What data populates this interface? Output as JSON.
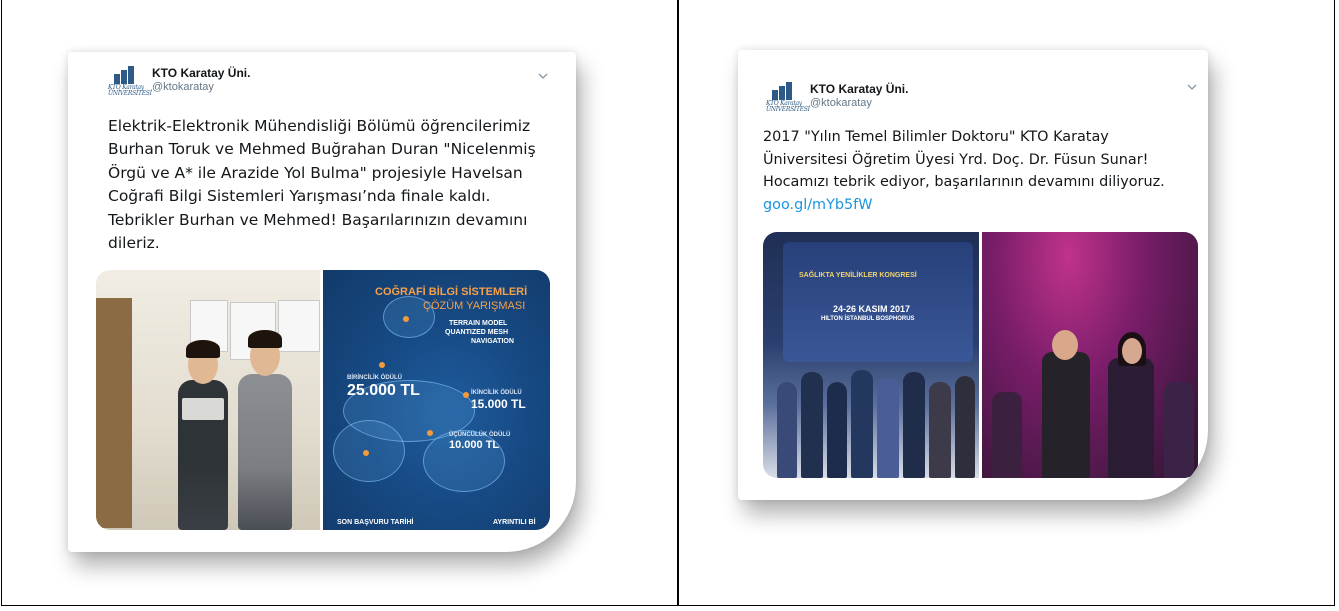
{
  "left_tweet": {
    "author_name": "KTO Karatay Üni.",
    "author_handle": "@ktokaratay",
    "logo_caption": "KTO Karatay ÜNİVERSİTESİ",
    "text_lines": [
      "Elektrik-Elektronik Mühendisliği Bölümü öğrencilerimiz",
      "Burhan Toruk ve Mehmed Buğrahan Duran \"Nicelenmiş",
      "Örgü ve A* ile Arazide Yol Bulma\" projesiyle Havelsan",
      "Coğrafi Bilgi Sistemleri Yarışması’nda finale kaldı.",
      "Tebrikler Burhan ve Mehmed! Başarılarınızın devamını",
      "dileriz."
    ],
    "poster": {
      "title_line1": "COĞRAFİ BİLGİ SİSTEMLERİ",
      "title_line2": "ÇÖZÜM YARIŞMASI",
      "tags": [
        "TERRAIN MODEL",
        "QUANTIZED MESH",
        "NAVIGATION"
      ],
      "first_label": "BİRİNCİLİK ÖDÜLÜ",
      "first_value": "25.000 TL",
      "second_label": "İKİNCİLİK ÖDÜLÜ",
      "second_value": "15.000 TL",
      "third_label": "ÜÇÜNCÜLÜK ÖDÜLÜ",
      "third_value": "10.000 TL",
      "footer_left": "SON BAŞVURU TARİHİ",
      "footer_right": "AYRINTILI Bİ"
    }
  },
  "right_tweet": {
    "author_name": "KTO Karatay Üni.",
    "author_handle": "@ktokaratay",
    "logo_caption": "KTO Karatay ÜNİVERSİTESİ",
    "text_lines": [
      "2017 \"Yılın Temel Bilimler Doktoru\" KTO Karatay",
      "Üniversitesi Öğretim Üyesi Yrd. Doç. Dr. Füsun Sunar!",
      "Hocamızı tebrik ediyor, başarılarının devamını diliyoruz."
    ],
    "link": "goo.gl/mYb5fW",
    "banner": {
      "title": "SAĞLIKTA YENİLİKLER KONGRESİ",
      "dates": "24-26 KASIM 2017",
      "venue": "HILTON İSTANBUL BOSPHORUS"
    }
  },
  "colors": {
    "link": "#1b95e0",
    "handle": "#657786",
    "text": "#14171a",
    "poster_orange": "#f5a04a",
    "poster_blue": "#174a84"
  },
  "icons": [
    "chevron-down-icon",
    "university-logo-icon"
  ]
}
